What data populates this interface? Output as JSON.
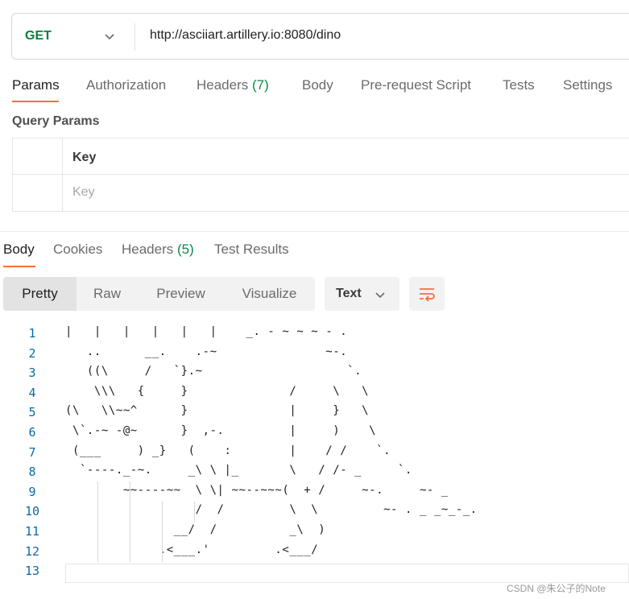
{
  "request": {
    "method": "GET",
    "url": "http://asciiart.artillery.io:8080/dino"
  },
  "request_tabs": [
    {
      "label": "Params",
      "active": true
    },
    {
      "label": "Authorization"
    },
    {
      "label": "Headers",
      "count": "(7)"
    },
    {
      "label": "Body"
    },
    {
      "label": "Pre-request Script"
    },
    {
      "label": "Tests"
    },
    {
      "label": "Settings"
    }
  ],
  "query_params": {
    "title": "Query Params",
    "key_header": "Key",
    "key_placeholder": "Key"
  },
  "response_tabs": [
    {
      "label": "Body",
      "active": true
    },
    {
      "label": "Cookies"
    },
    {
      "label": "Headers",
      "count": "(5)"
    },
    {
      "label": "Test Results"
    }
  ],
  "view_modes": [
    "Pretty",
    "Raw",
    "Preview",
    "Visualize"
  ],
  "active_view": "Pretty",
  "format": "Text",
  "icons": {
    "method_dropdown": "chevron-down-icon",
    "format_dropdown": "chevron-down-icon",
    "wrap": "wrap-lines-icon"
  },
  "colors": {
    "method": "#0b7f3f",
    "accent": "#ff6c37",
    "count": "#0b8a45",
    "line_numbers": "#0a6aa6"
  },
  "code_lines": [
    {
      "n": "1",
      "text": "|   |   |   |   |   |    _. - ~ ~ ~ - ."
    },
    {
      "n": "2",
      "text": "   ..      __.    .-~               ~-."
    },
    {
      "n": "3",
      "text": "   ((\\     /   `}.~                    `."
    },
    {
      "n": "4",
      "text": "    \\\\\\   {     }              /     \\   \\"
    },
    {
      "n": "5",
      "text": "(\\   \\\\~~^      }              |     }   \\"
    },
    {
      "n": "6",
      "text": " \\`.-~ -@~      }  ,-.         |     )    \\"
    },
    {
      "n": "7",
      "text": " (___     ) _}   (    :        |    / /    `."
    },
    {
      "n": "8",
      "text": "  `----._-~.     _\\ \\ |_       \\   / /- _     `."
    },
    {
      "n": "9",
      "text": "        ~~----~~  \\ \\| ~~--~~~(  + /     ~-.     ~- _"
    },
    {
      "n": "10",
      "text": "                  /  /         \\  \\         ~- . _ _~_-_."
    },
    {
      "n": "11",
      "text": "               __/  /          _\\  )"
    },
    {
      "n": "12",
      "text": "             .<___.'         .<___/"
    },
    {
      "n": "13",
      "text": ""
    }
  ],
  "watermark": "CSDN @朱公子的Note"
}
